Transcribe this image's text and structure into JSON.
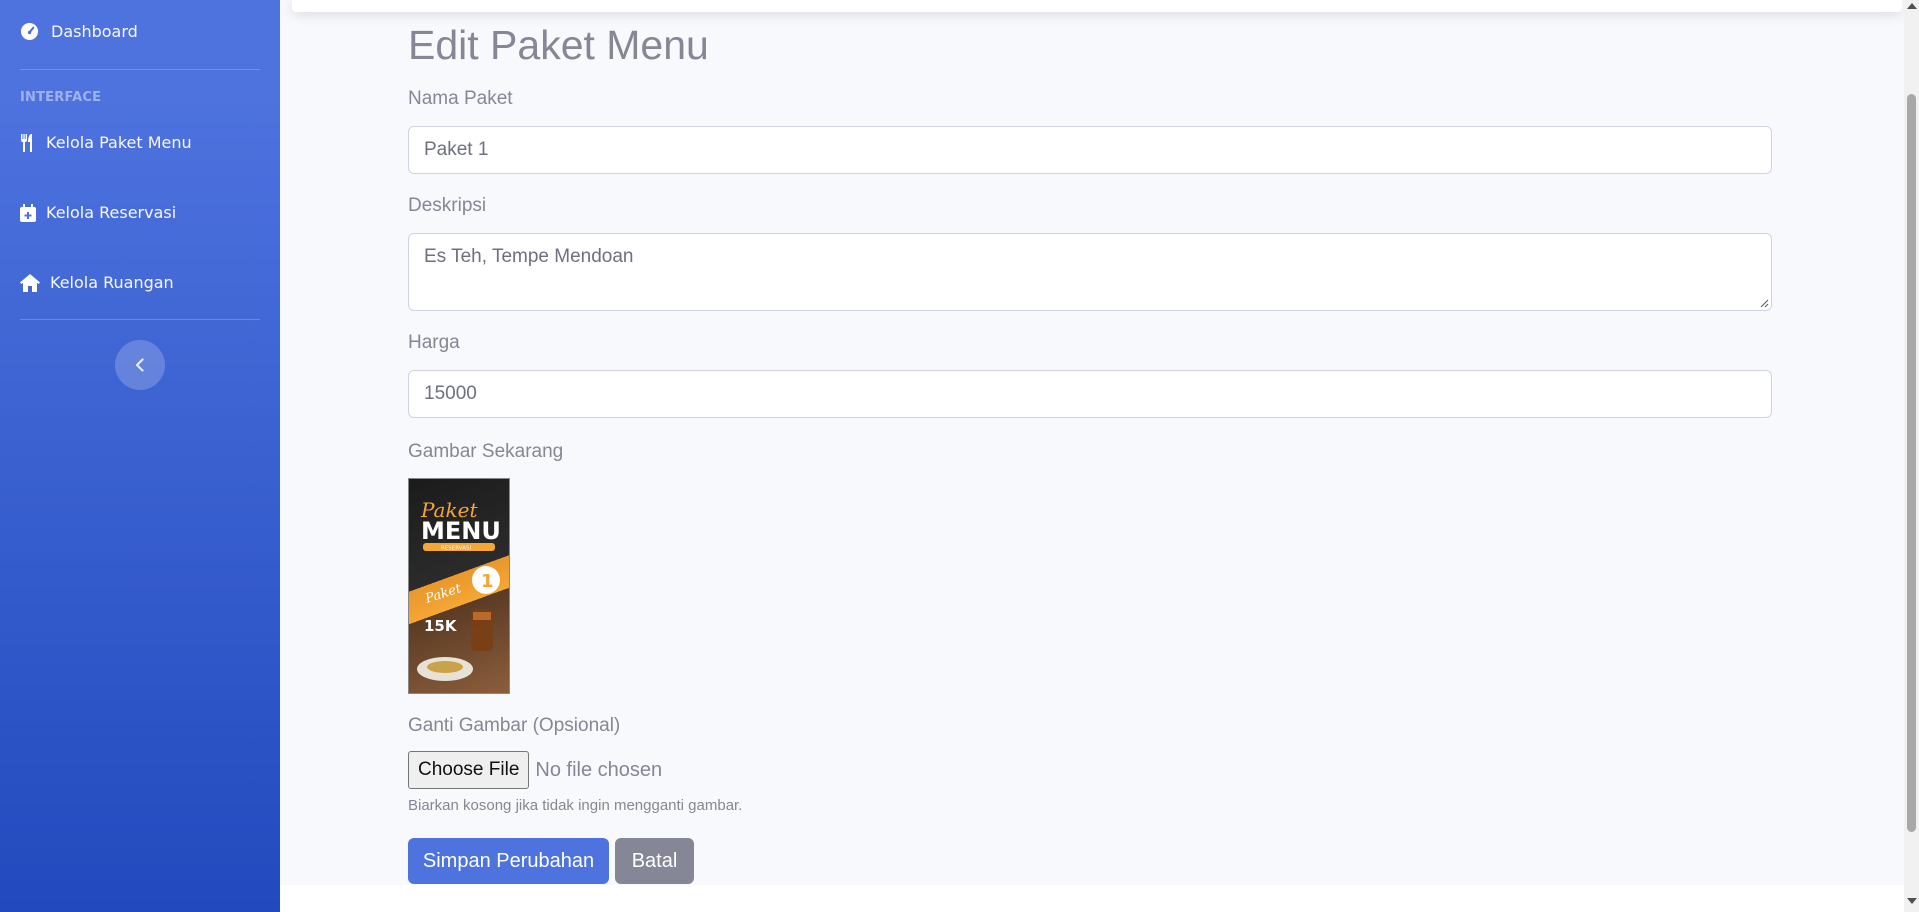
{
  "sidebar": {
    "dashboard_label": "Dashboard",
    "section_heading": "INTERFACE",
    "items": [
      {
        "label": "Kelola Paket Menu",
        "icon": "utensils-icon"
      },
      {
        "label": "Kelola Reservasi",
        "icon": "calendar-plus-icon"
      },
      {
        "label": "Kelola Ruangan",
        "icon": "home-icon"
      }
    ],
    "toggle_icon": "chevron-left-icon",
    "gradient_top": "#4e73df",
    "gradient_bottom": "#224abe"
  },
  "page": {
    "title": "Edit Paket Menu"
  },
  "form": {
    "name_label": "Nama Paket",
    "name_value": "Paket 1",
    "description_label": "Deskripsi",
    "description_value": "Es Teh, Tempe Mendoan",
    "price_label": "Harga",
    "price_value": "15000",
    "current_image_label": "Gambar Sekarang",
    "replace_image_label": "Ganti Gambar (Opsional)",
    "choose_file_label": "Choose File",
    "no_file_text": "No file chosen",
    "help_text": "Biarkan kosong jika tidak ingin mengganti gambar.",
    "save_label": "Simpan Perubahan",
    "cancel_label": "Batal"
  },
  "image_preview": {
    "line1": "Paket",
    "line2": "MENU",
    "line3": "RESERVASI",
    "badge": "1",
    "script_label": "Paket",
    "price": "15K"
  },
  "colors": {
    "primary": "#4e73df",
    "secondary": "#858796"
  }
}
